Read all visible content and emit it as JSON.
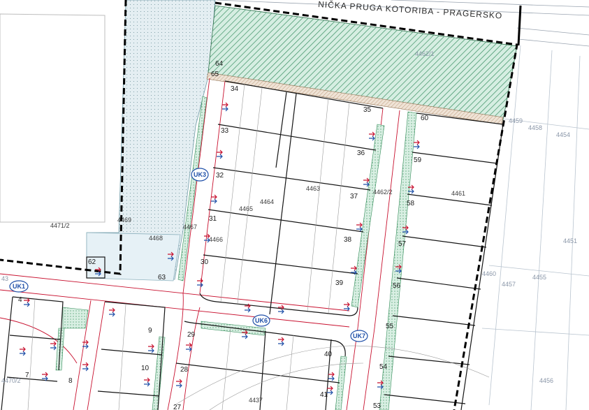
{
  "railway_title": "NIČKA PRUGA KOTORIBA - PRAGERSKO",
  "colors": {
    "plot_line": "#111111",
    "boundary": "#000000",
    "green_hatch": "#3a8f63",
    "green_fill": "#cfe9dc",
    "dotted_fill": "#dbe9ee",
    "road_edge": "#c8102e",
    "arrow_red": "#c8102e",
    "arrow_blue": "#1e4fa8",
    "faint_text": "#8a96a8"
  },
  "parcels": {
    "p4462_1": "4462/1",
    "p4459": "4459",
    "p4458": "4458",
    "p4454": "4454",
    "p4471_2": "4471/2",
    "p4469": "4469",
    "p4468": "4468",
    "p4467": "4467",
    "p4466": "4466",
    "p4465": "4465",
    "p4464": "4464",
    "p4463": "4463",
    "p4462_2": "4462/2",
    "p4461": "4461",
    "p4460": "4460",
    "p4457": "4457",
    "p4455": "4455",
    "p4451": "4451",
    "p4456": "4456",
    "p4437": "4437",
    "p4470_2": "4470/2",
    "p43": "43"
  },
  "lots": {
    "l64": "64",
    "l65": "65",
    "l34": "34",
    "l33": "33",
    "l32": "32",
    "l31": "31",
    "l30": "30",
    "l35": "35",
    "l36": "36",
    "l37": "37",
    "l38": "38",
    "l39": "39",
    "l60": "60",
    "l59": "59",
    "l58": "58",
    "l57": "57",
    "l56": "56",
    "l55": "55",
    "l54": "54",
    "l53": "53",
    "l62": "62",
    "l63": "63",
    "l4": "4",
    "l9": "9",
    "l10": "10",
    "l7": "7",
    "l8": "8",
    "l29": "29",
    "l28": "28",
    "l27": "27",
    "l40": "40",
    "l41": "41"
  },
  "uk_nodes": {
    "uk1": "UK1",
    "uk3": "UK3",
    "uk6": "UK6",
    "uk7": "UK7"
  },
  "icons": [
    "red-arrow-icon",
    "blue-arrow-icon",
    "utility-node-icon"
  ]
}
